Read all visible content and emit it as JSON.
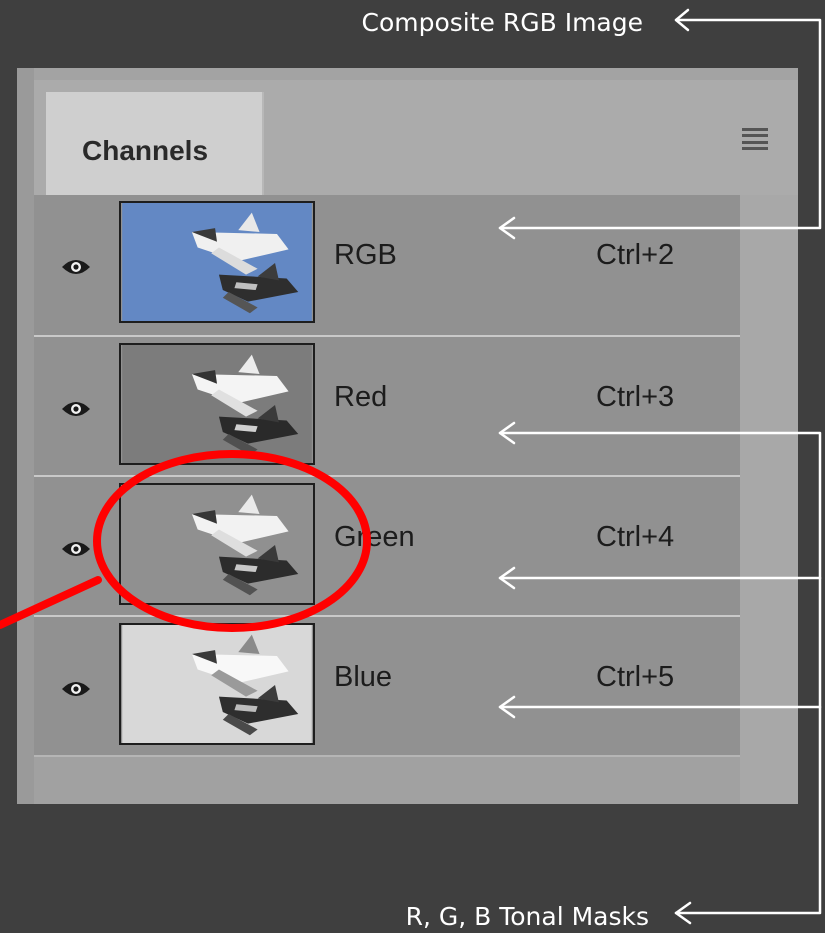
{
  "annotations": {
    "top_label": "Composite RGB Image",
    "bottom_label": "R, G, B Tonal Masks"
  },
  "panel": {
    "tab_label": "Channels",
    "menu_icon": "hamburger-menu-icon",
    "channels": [
      {
        "name": "RGB",
        "shortcut": "Ctrl+2",
        "thumb_bg": "#6388c4"
      },
      {
        "name": "Red",
        "shortcut": "Ctrl+3",
        "thumb_bg": "#7c7c7c"
      },
      {
        "name": "Green",
        "shortcut": "Ctrl+4",
        "thumb_bg": "#909090"
      },
      {
        "name": "Blue",
        "shortcut": "Ctrl+5",
        "thumb_bg": "#d8d8d8"
      }
    ]
  },
  "colors": {
    "highlight_circle": "#ff0000",
    "annotation_arrows": "#ffffff"
  }
}
